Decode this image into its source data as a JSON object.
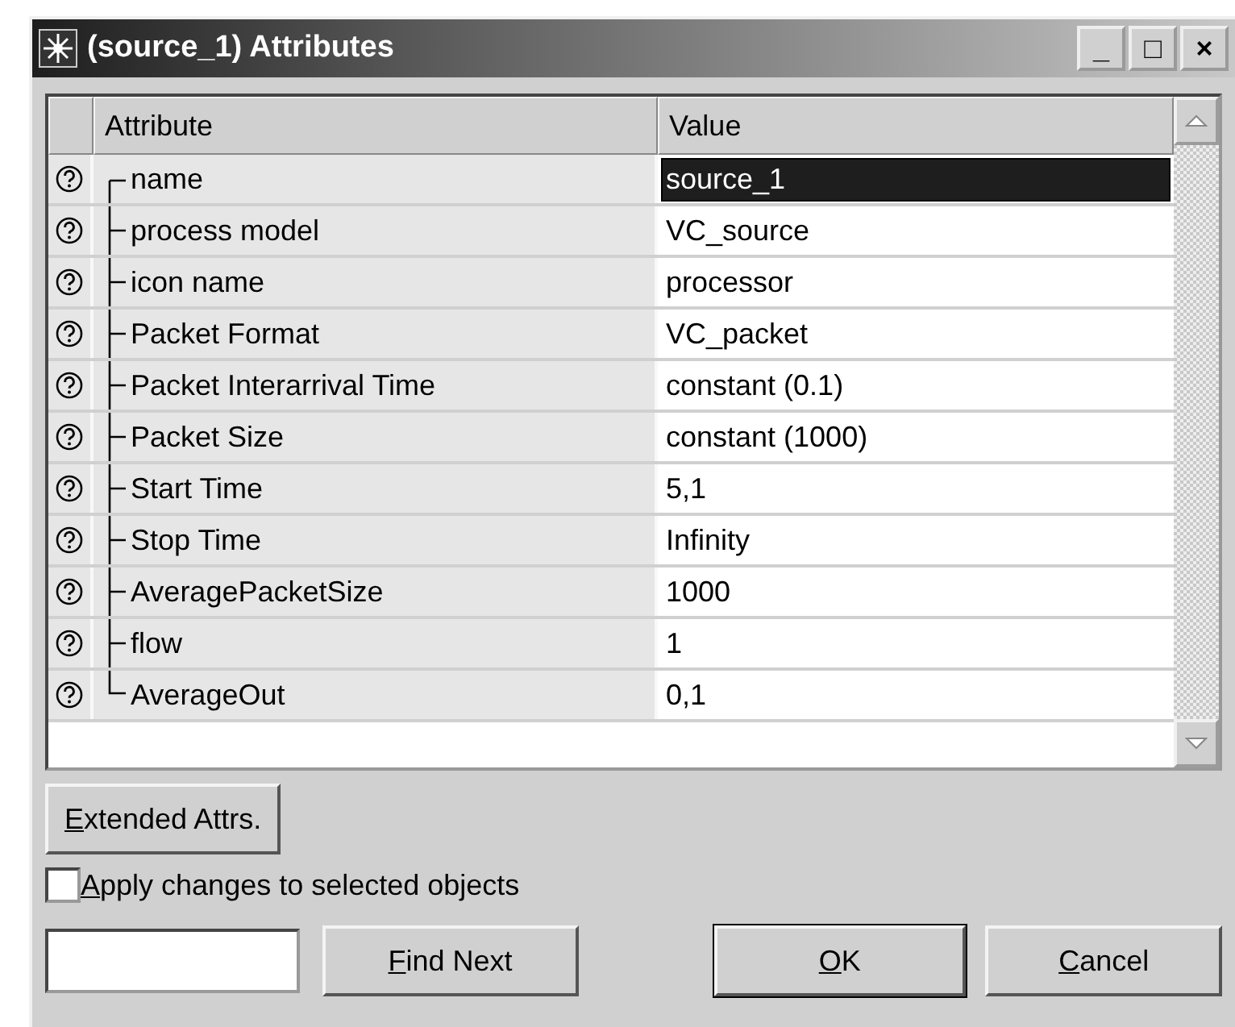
{
  "window": {
    "title": "(source_1) Attributes",
    "controls": [
      "_",
      "□",
      "×"
    ]
  },
  "table": {
    "columns": [
      "Attribute",
      "Value"
    ],
    "rows": [
      {
        "attribute": "name",
        "value": "source_1",
        "selected": true
      },
      {
        "attribute": "process model",
        "value": "VC_source",
        "selected": false
      },
      {
        "attribute": "icon name",
        "value": "processor",
        "selected": false
      },
      {
        "attribute": "Packet Format",
        "value": "VC_packet",
        "selected": false
      },
      {
        "attribute": "Packet Interarrival Time",
        "value": "constant (0.1)",
        "selected": false
      },
      {
        "attribute": "Packet Size",
        "value": "constant (1000)",
        "selected": false
      },
      {
        "attribute": "Start Time",
        "value": "5,1",
        "selected": false
      },
      {
        "attribute": "Stop Time",
        "value": "Infinity",
        "selected": false
      },
      {
        "attribute": "AveragePacketSize",
        "value": "1000",
        "selected": false
      },
      {
        "attribute": "flow",
        "value": "1",
        "selected": false
      },
      {
        "attribute": "AverageOut",
        "value": "0,1",
        "selected": false
      }
    ]
  },
  "extended_button": {
    "key": "E",
    "rest": "xtended Attrs."
  },
  "apply_checkbox": {
    "key": "A",
    "rest": "pply changes to selected objects",
    "checked": false
  },
  "buttons": [
    {
      "key": "F",
      "rest": "ind Next",
      "kind": "find"
    },
    {
      "key": "O",
      "rest": "K",
      "kind": "ok"
    },
    {
      "key": "C",
      "rest": "ancel",
      "kind": "cancel"
    }
  ]
}
